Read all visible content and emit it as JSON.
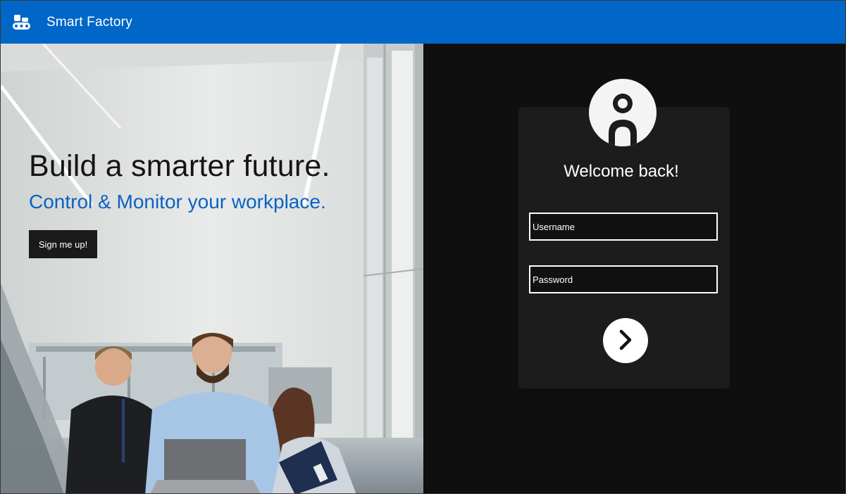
{
  "header": {
    "app_title": "Smart Factory",
    "logo_icon": "conveyor-robot-icon",
    "color": "#0066c8"
  },
  "hero": {
    "headline": "Build a smarter future.",
    "subline": "Control & Monitor your workplace.",
    "signup_label": "Sign me up!",
    "subline_color": "#0a63c2"
  },
  "login": {
    "avatar_icon": "account-circle-icon",
    "welcome": "Welcome back!",
    "username_placeholder": "Username",
    "password_placeholder": "Password",
    "submit_icon": "chevron-right-icon"
  }
}
